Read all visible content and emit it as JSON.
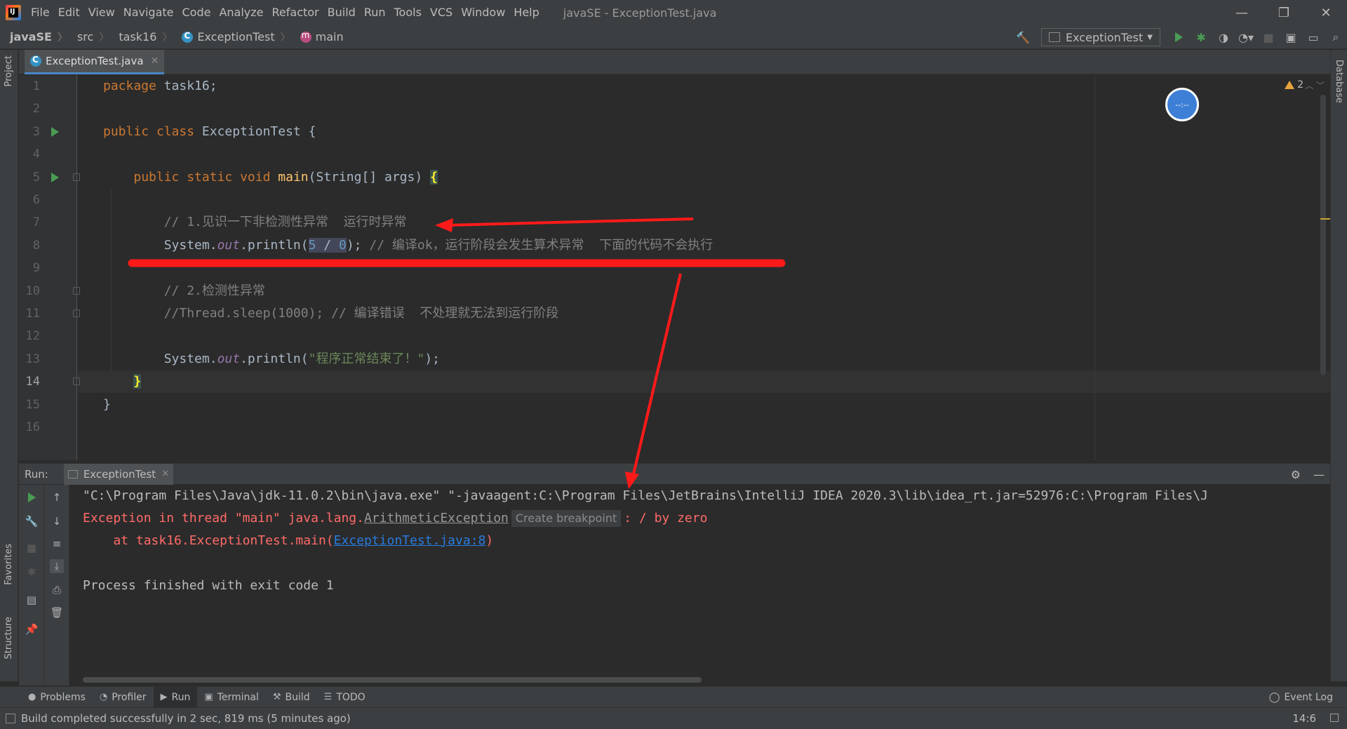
{
  "window": {
    "title": "javaSE - ExceptionTest.java",
    "menu": [
      "File",
      "Edit",
      "View",
      "Navigate",
      "Code",
      "Analyze",
      "Refactor",
      "Build",
      "Run",
      "Tools",
      "VCS",
      "Window",
      "Help"
    ],
    "controls": {
      "minimize": "—",
      "restore": "❐",
      "close": "✕"
    }
  },
  "breadcrumb": {
    "project": "javaSE",
    "dir1": "src",
    "dir2": "task16",
    "class": "ExceptionTest",
    "method": "main"
  },
  "toolbar": {
    "run_config": "ExceptionTest"
  },
  "side_tabs": {
    "project": "Project",
    "favorites": "Favorites",
    "structure": "Structure",
    "database": "Database"
  },
  "editor": {
    "tab": "ExceptionTest.java",
    "tab_close": "✕",
    "warnings_count": "2",
    "line_numbers": [
      "1",
      "2",
      "3",
      "4",
      "5",
      "6",
      "7",
      "8",
      "9",
      "10",
      "11",
      "12",
      "13",
      "14",
      "15",
      "16"
    ],
    "lines": {
      "l1_kw": "package",
      "l1_rest": " task16;",
      "l3_kw": "public class",
      "l3_rest": " ExceptionTest {",
      "l5_indent": "    ",
      "l5_kw": "public static void",
      "l5_fn": " main",
      "l5_rest": "(String[] args) ",
      "l5_brace": "{",
      "l7_cmt": "        // 1.见识一下非检测性异常  运行时异常",
      "l8_a": "        System.",
      "l8_out": "out",
      "l8_b": ".println(",
      "l8_num5": "5",
      "l8_op": " / ",
      "l8_num0": "0",
      "l8_c": ");",
      "l8_cmt": " // 编译ok，运行阶段会发生算术异常  下面的代码不会执行",
      "l10_cmt": "        // 2.检测性异常",
      "l11_cmt": "        //Thread.sleep(1000); // 编译错误  不处理就无法到运行阶段",
      "l13_a": "        System.",
      "l13_out": "out",
      "l13_b": ".println(",
      "l13_str": "\"程序正常结束了！\"",
      "l13_c": ");",
      "l14_indent": "    ",
      "l14_brace": "}",
      "l15": "}"
    }
  },
  "run_panel": {
    "label": "Run:",
    "tab": "ExceptionTest",
    "tab_close": "✕",
    "console": {
      "cmd": "\"C:\\Program Files\\Java\\jdk-11.0.2\\bin\\java.exe\" \"-javaagent:C:\\Program Files\\JetBrains\\IntelliJ IDEA 2020.3\\lib\\idea_rt.jar=52976:C:\\Program Files\\J",
      "exc_prefix": "Exception in thread \"main\" java.lang.",
      "exc_class": "ArithmeticException",
      "tooltip": "Create breakpoint",
      "exc_suffix": ": / by zero",
      "at_prefix": "    at task16.ExceptionTest.main(",
      "at_link": "ExceptionTest.java:8",
      "at_suffix": ")",
      "finished": "Process finished with exit code 1"
    }
  },
  "bottom_tabs": [
    "Problems",
    "Profiler",
    "Run",
    "Terminal",
    "Build",
    "TODO"
  ],
  "event_log": "Event Log",
  "status": {
    "message": "Build completed successfully in 2 sec, 819 ms (5 minutes ago)",
    "caret": "14:6"
  },
  "colors": {
    "annotation_red": "#ff1a1a",
    "accent_blue": "#4a88c7",
    "run_green": "#499c54"
  }
}
